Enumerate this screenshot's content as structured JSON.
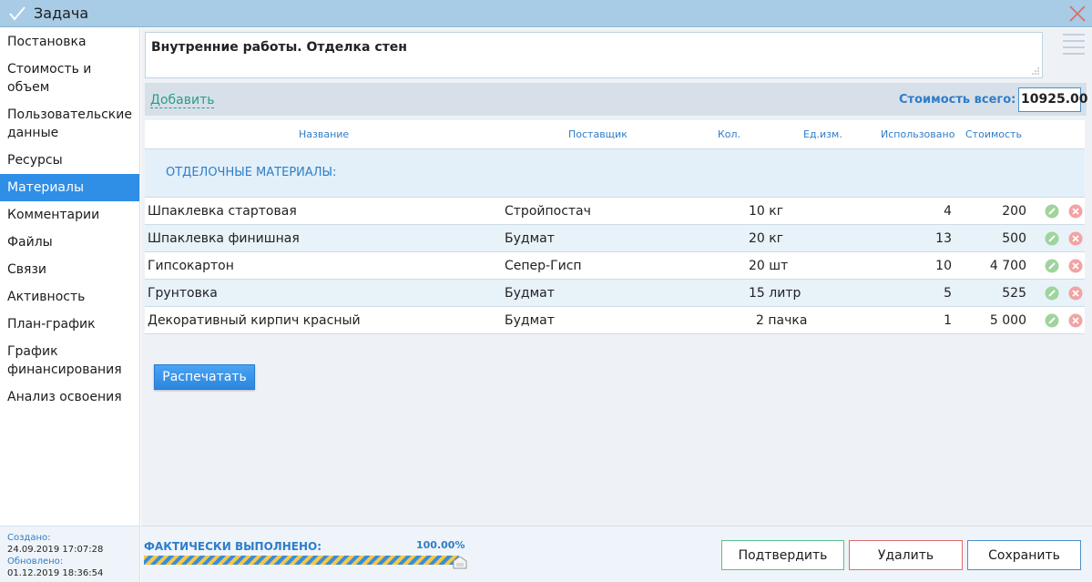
{
  "window": {
    "title": "Задача",
    "close_icon": "close-icon",
    "check_icon": "check-icon"
  },
  "sidebar": {
    "items": [
      {
        "label": "Постановка"
      },
      {
        "label": "Стоимость и объем"
      },
      {
        "label": "Пользовательские данные"
      },
      {
        "label": "Ресурсы"
      },
      {
        "label": "Материалы",
        "active": true
      },
      {
        "label": "Комментарии"
      },
      {
        "label": "Файлы"
      },
      {
        "label": "Связи"
      },
      {
        "label": "Активность"
      },
      {
        "label": "План-график"
      },
      {
        "label": "График финансирования"
      },
      {
        "label": "Анализ освоения"
      }
    ]
  },
  "meta": {
    "created_label": "Создано:",
    "created_value": "24.09.2019 17:07:28",
    "updated_label": "Обновлено:",
    "updated_value": "01.12.2019 18:36:54"
  },
  "task": {
    "title": "Внутренние работы. Отделка стен"
  },
  "toolbar": {
    "add_label": "Добавить",
    "total_label": "Стоимость всего:",
    "total_value": "10925.00"
  },
  "table": {
    "columns": {
      "name": "Название",
      "supplier": "Поставщик",
      "qty": "Кол.",
      "unit": "Ед.изм.",
      "used": "Использовано",
      "cost": "Стоимость"
    },
    "group_label": "ОТДЕЛОЧНЫЕ МАТЕРИАЛЫ:",
    "rows": [
      {
        "name": "Шпаклевка стартовая",
        "supplier": "Стройпостач",
        "qty": "10",
        "unit": "кг",
        "used": "4",
        "cost": "200"
      },
      {
        "name": "Шпаклевка финишная",
        "supplier": "Будмат",
        "qty": "20",
        "unit": "кг",
        "used": "13",
        "cost": "500"
      },
      {
        "name": "Гипсокартон",
        "supplier": "Сепер-Гисп",
        "qty": "20",
        "unit": "шт",
        "used": "10",
        "cost": "4 700"
      },
      {
        "name": "Грунтовка",
        "supplier": "Будмат",
        "qty": "15",
        "unit": "литр",
        "used": "5",
        "cost": "525"
      },
      {
        "name": "Декоративный кирпич красный",
        "supplier": "Будмат",
        "qty": "2",
        "unit": "пачка",
        "used": "1",
        "cost": "5 000"
      }
    ],
    "row_icons": [
      "edit-icon",
      "delete-icon"
    ]
  },
  "print_label": "Распечатать",
  "progress": {
    "label": "ФАКТИЧЕСКИ ВЫПОЛНЕНО:",
    "percent_text": "100.00%",
    "value": 1.0
  },
  "actions": {
    "confirm": "Подтвердить",
    "delete": "Удалить",
    "save": "Сохранить"
  },
  "colors": {
    "accent": "#2f8ee6",
    "titlebar": "#a8cbe6",
    "link": "#2a9d8a",
    "confirm": "#5cbf8e",
    "delete": "#e26b6b"
  }
}
